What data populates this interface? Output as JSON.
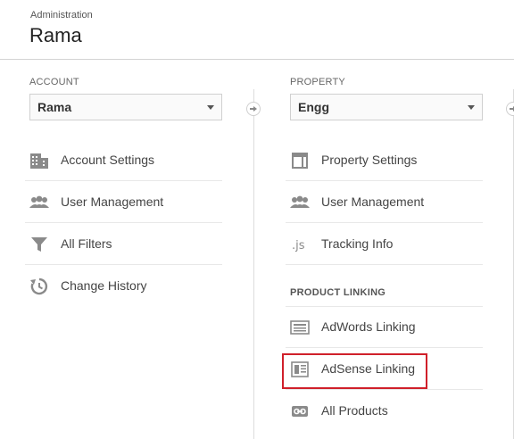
{
  "header": {
    "section_label": "Administration",
    "title": "Rama"
  },
  "account": {
    "label": "ACCOUNT",
    "selected": "Rama",
    "items": [
      {
        "label": "Account Settings",
        "icon": "building-icon"
      },
      {
        "label": "User Management",
        "icon": "users-icon"
      },
      {
        "label": "All Filters",
        "icon": "filter-icon"
      },
      {
        "label": "Change History",
        "icon": "history-icon"
      }
    ]
  },
  "property": {
    "label": "PROPERTY",
    "selected": "Engg",
    "items": [
      {
        "label": "Property Settings",
        "icon": "layout-icon"
      },
      {
        "label": "User Management",
        "icon": "users-icon"
      },
      {
        "label": "Tracking Info",
        "icon": "js-icon"
      }
    ],
    "product_linking": {
      "heading": "PRODUCT LINKING",
      "items": [
        {
          "label": "AdWords Linking",
          "icon": "adwords-icon"
        },
        {
          "label": "AdSense Linking",
          "icon": "adsense-icon"
        },
        {
          "label": "All Products",
          "icon": "link-icon"
        }
      ]
    }
  },
  "colors": {
    "highlight": "#d0202a",
    "icon": "#8a8a8a"
  }
}
